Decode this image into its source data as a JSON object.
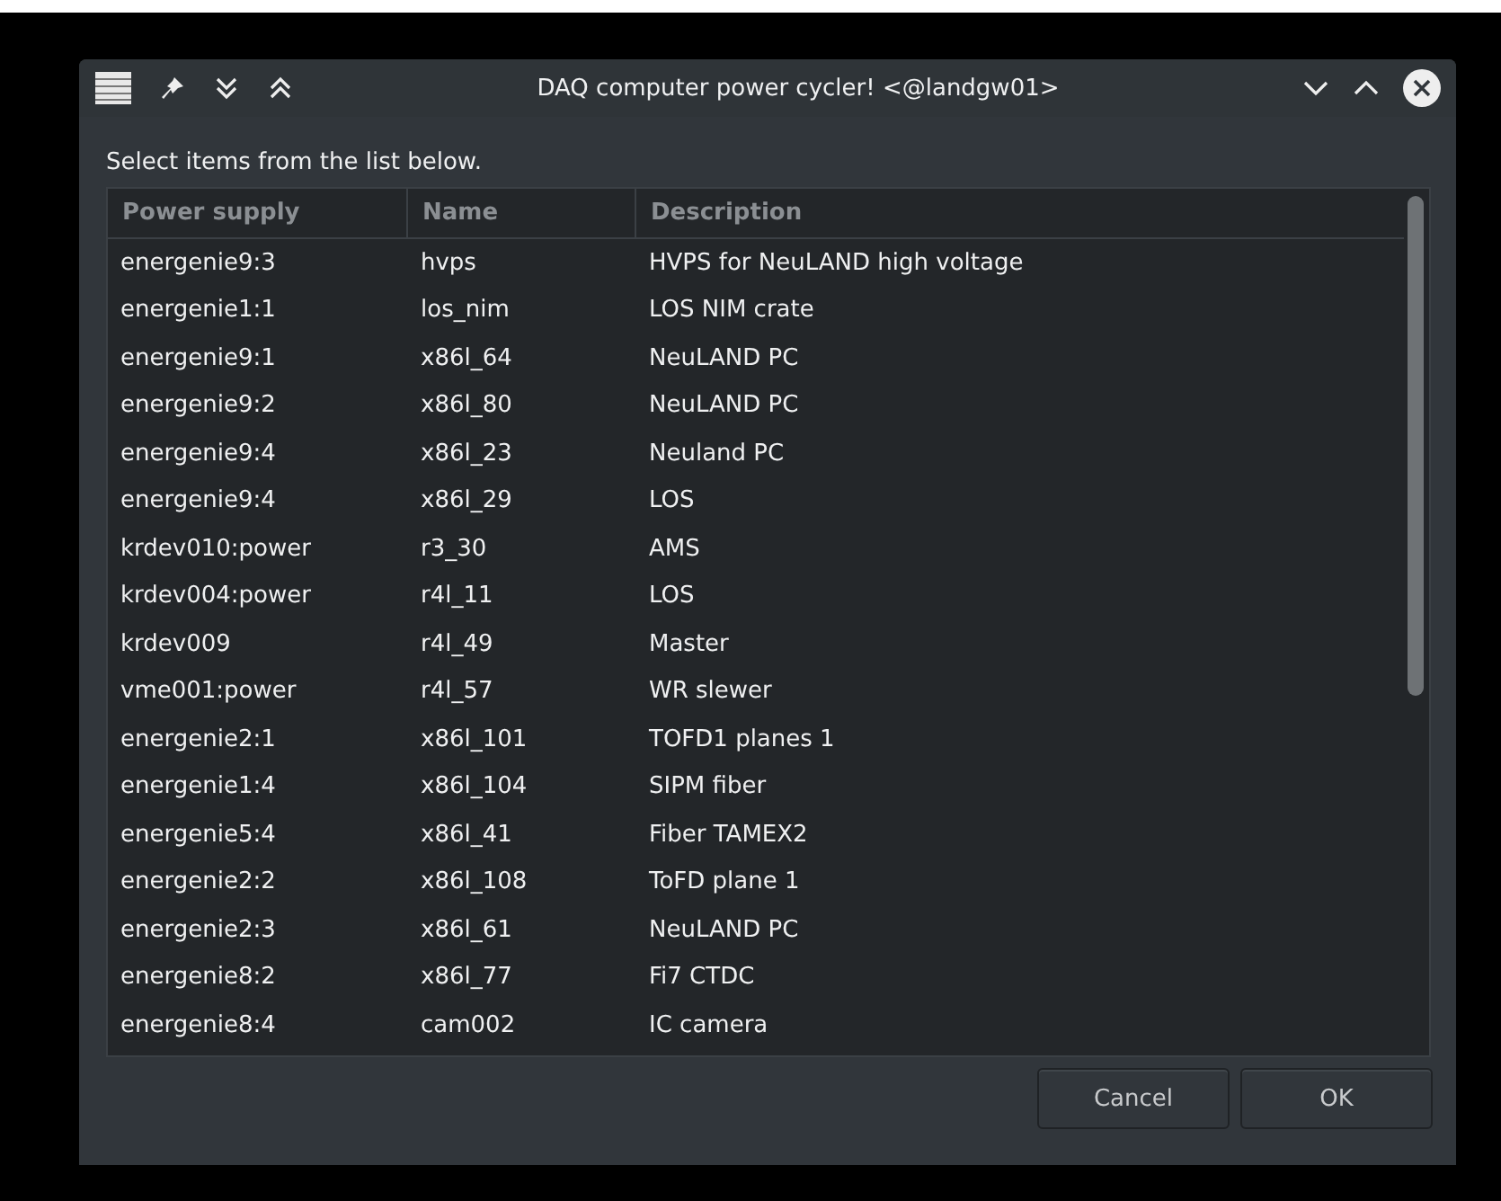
{
  "window": {
    "title": "DAQ computer power cycler! <@landgw01>"
  },
  "prompt": "Select items from the list below.",
  "table": {
    "columns": [
      "Power supply",
      "Name",
      "Description"
    ],
    "rows": [
      [
        "energenie9:3",
        "hvps",
        "HVPS for NeuLAND high voltage"
      ],
      [
        "energenie1:1",
        "los_nim",
        "LOS NIM crate"
      ],
      [
        "energenie9:1",
        "x86l_64",
        "NeuLAND PC"
      ],
      [
        "energenie9:2",
        "x86l_80",
        "NeuLAND PC"
      ],
      [
        "energenie9:4",
        "x86l_23",
        "Neuland PC"
      ],
      [
        "energenie9:4",
        "x86l_29",
        "LOS"
      ],
      [
        "krdev010:power",
        "r3_30",
        "AMS"
      ],
      [
        "krdev004:power",
        "r4l_11",
        "LOS"
      ],
      [
        "krdev009",
        "r4l_49",
        "Master"
      ],
      [
        "vme001:power",
        "r4l_57",
        "WR slewer"
      ],
      [
        "energenie2:1",
        "x86l_101",
        "TOFD1 planes 1"
      ],
      [
        "energenie1:4",
        "x86l_104",
        "SIPM fiber"
      ],
      [
        "energenie5:4",
        "x86l_41",
        "Fiber TAMEX2"
      ],
      [
        "energenie2:2",
        "x86l_108",
        "ToFD plane 1"
      ],
      [
        "energenie2:3",
        "x86l_61",
        "NeuLAND PC"
      ],
      [
        "energenie8:2",
        "x86l_77",
        "Fi7 CTDC"
      ],
      [
        "energenie8:4",
        "cam002",
        "IC camera"
      ]
    ]
  },
  "buttons": [
    "Cancel",
    "OK"
  ]
}
